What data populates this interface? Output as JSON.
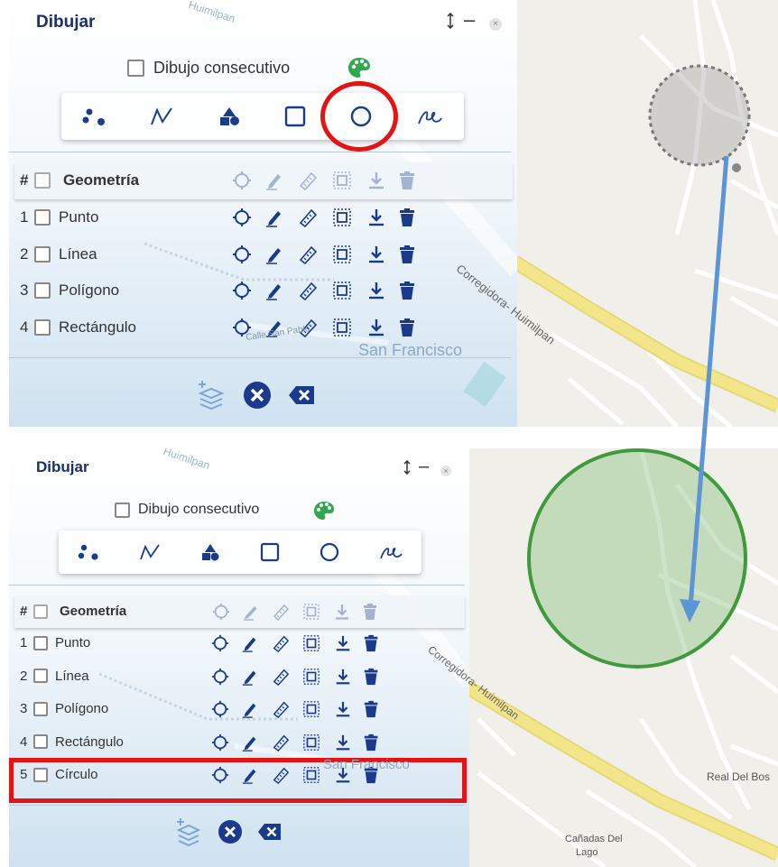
{
  "panel": {
    "title": "Dibujar",
    "consecutive_label": "Dibujo consecutivo",
    "header_hash": "#",
    "header_label": "Geometría"
  },
  "tools": [
    "points-icon",
    "line-icon",
    "polygon-icon",
    "rectangle-icon",
    "circle-icon",
    "freehand-icon"
  ],
  "before": {
    "rows": [
      {
        "num": "1",
        "label": "Punto"
      },
      {
        "num": "2",
        "label": "Línea"
      },
      {
        "num": "3",
        "label": "Polígono"
      },
      {
        "num": "4",
        "label": "Rectángulo"
      }
    ]
  },
  "after": {
    "rows": [
      {
        "num": "1",
        "label": "Punto"
      },
      {
        "num": "2",
        "label": "Línea"
      },
      {
        "num": "3",
        "label": "Polígono"
      },
      {
        "num": "4",
        "label": "Rectángulo"
      },
      {
        "num": "5",
        "label": "Círculo"
      }
    ]
  },
  "map": {
    "street_1": "Corregidora- Huimilpan",
    "street_2": "Calle San Pablo",
    "place_1": "San Francisco",
    "place_2": "Real Del Bos",
    "place_3": "Cañadas Del",
    "place_4": "Lago",
    "place_5": "Huimilpan"
  },
  "colors": {
    "accent": "#1b3a8c",
    "title": "#1b2f6b",
    "annotation_red": "#e31414",
    "arrow_blue": "#5b95d6",
    "circle_green": "#3f9a3c",
    "road_yellow": "#f3e58a"
  }
}
